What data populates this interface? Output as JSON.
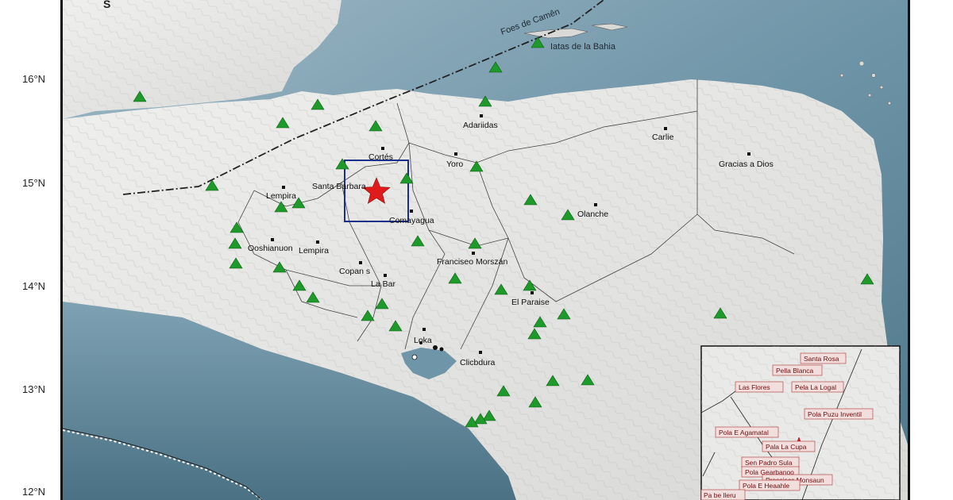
{
  "corner_text": "S",
  "latitude_labels": [
    "16°N",
    "15°N",
    "14°N",
    "13°N",
    "12°N"
  ],
  "sea_labels": {
    "fault": "Foes de Camên",
    "islands": "Iatas de la Bahia"
  },
  "places": [
    "Adariidas",
    "Carlie",
    "Cortés",
    "Santa Barbara",
    "Yoro",
    "Gracias a Dios",
    "Lempira",
    "Comayagua",
    "Olanche",
    "Ooshianuon",
    "Lempira",
    "Franciseo Morszán",
    "Copan s",
    "La Bar",
    "El Paraise",
    "Loka",
    "Clicbdura"
  ],
  "inset_labels": [
    "Santa Rosa",
    "Pella Blanca",
    "Las Flores",
    "Pela La Logal",
    "Pola Puzu Inventil",
    "Pola E Agamatal",
    "Pala La Cupa",
    "Sen Padro Sula",
    "Pola Gearbanoo",
    "Prossiscs Monsaun",
    "Pola E Heaahle",
    "Pa be lleru"
  ],
  "colors": {
    "sea": "#6f95a8",
    "land": "#e4e4e2",
    "station": "#1e9a2a",
    "epicenter": "#e01b1b",
    "zone_box": "#1a2f8a"
  },
  "icons": {
    "station": "green-triangle",
    "epicenter": "red-star",
    "town": "black-square"
  }
}
